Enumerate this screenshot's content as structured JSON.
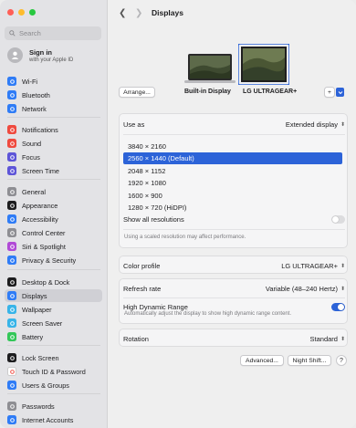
{
  "window": {
    "traffic_colors": [
      "#ff5f57",
      "#febc2e",
      "#28c840"
    ]
  },
  "sidebar": {
    "search_placeholder": "Search",
    "signin": {
      "title": "Sign in",
      "subtitle": "with your Apple ID"
    },
    "items": [
      {
        "label": "Wi-Fi",
        "icon": "wifi-icon",
        "color": "#2f7cf6"
      },
      {
        "label": "Bluetooth",
        "icon": "bluetooth-icon",
        "color": "#2f7cf6"
      },
      {
        "label": "Network",
        "icon": "globe-icon",
        "color": "#2f7cf6"
      },
      {
        "label": "Notifications",
        "icon": "bell-icon",
        "color": "#ef4a3f"
      },
      {
        "label": "Sound",
        "icon": "speaker-icon",
        "color": "#ef4a3f"
      },
      {
        "label": "Focus",
        "icon": "moon-icon",
        "color": "#5e55d8"
      },
      {
        "label": "Screen Time",
        "icon": "hourglass-icon",
        "color": "#5e55d8"
      },
      {
        "label": "General",
        "icon": "gear-icon",
        "color": "#8e8e93"
      },
      {
        "label": "Appearance",
        "icon": "circle-half-icon",
        "color": "#1d1d1f"
      },
      {
        "label": "Accessibility",
        "icon": "accessibility-icon",
        "color": "#2f7cf6"
      },
      {
        "label": "Control Center",
        "icon": "switches-icon",
        "color": "#8e8e93"
      },
      {
        "label": "Siri & Spotlight",
        "icon": "siri-icon",
        "color": "#b14ad6"
      },
      {
        "label": "Privacy & Security",
        "icon": "hand-icon",
        "color": "#2f7cf6"
      },
      {
        "label": "Desktop & Dock",
        "icon": "dock-icon",
        "color": "#1d1d1f"
      },
      {
        "label": "Displays",
        "icon": "sun-icon",
        "color": "#2f7cf6"
      },
      {
        "label": "Wallpaper",
        "icon": "wallpaper-icon",
        "color": "#38b4e8"
      },
      {
        "label": "Screen Saver",
        "icon": "screensaver-icon",
        "color": "#38b4e8"
      },
      {
        "label": "Battery",
        "icon": "battery-icon",
        "color": "#34c759"
      },
      {
        "label": "Lock Screen",
        "icon": "lock-icon",
        "color": "#1d1d1f"
      },
      {
        "label": "Touch ID & Password",
        "icon": "fingerprint-icon",
        "color": "#ffffff"
      },
      {
        "label": "Users & Groups",
        "icon": "users-icon",
        "color": "#2f7cf6"
      },
      {
        "label": "Passwords",
        "icon": "key-icon",
        "color": "#8e8e93"
      },
      {
        "label": "Internet Accounts",
        "icon": "at-icon",
        "color": "#2f7cf6"
      }
    ],
    "active_label": "Displays"
  },
  "main": {
    "title": "Displays",
    "arrange_label": "Arrange...",
    "builtin_label": "Built-in Display",
    "external_label": "LG ULTRAGEAR+",
    "add_label": "+",
    "use_as": {
      "label": "Use as",
      "value": "Extended display"
    },
    "resolutions": [
      "3840 × 2160",
      "2560 × 1440 (Default)",
      "2048 × 1152",
      "1920 × 1080",
      "1600 × 900",
      "1280 × 720 (HiDPI)"
    ],
    "selected_resolution": "2560 × 1440 (Default)",
    "show_all": {
      "label": "Show all resolutions",
      "on": false
    },
    "scaled_note": "Using a scaled resolution may affect performance.",
    "color_profile": {
      "label": "Color profile",
      "value": "LG ULTRAGEAR+"
    },
    "refresh_rate": {
      "label": "Refresh rate",
      "value": "Variable (48–240 Hertz)"
    },
    "hdr": {
      "label": "High Dynamic Range",
      "sublabel": "Automatically adjust the display to show high dynamic range content.",
      "on": true
    },
    "rotation": {
      "label": "Rotation",
      "value": "Standard"
    },
    "advanced_label": "Advanced...",
    "night_shift_label": "Night Shift...",
    "help_label": "?",
    "accent_color": "#2c63d8"
  }
}
